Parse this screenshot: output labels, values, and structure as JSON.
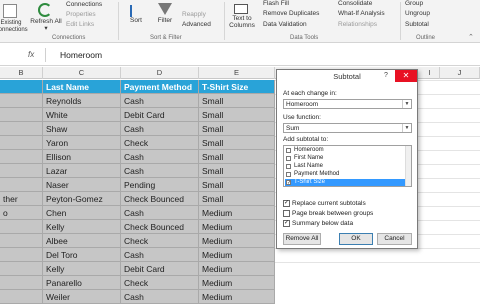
{
  "ribbon": {
    "existing_connections": "Existing Connections",
    "refresh_all": "Refresh All",
    "refresh_arrow": "▾",
    "connections": "Connections",
    "properties": "Properties",
    "edit_links": "Edit Links",
    "group_connections": "Connections",
    "sort": "Sort",
    "filter": "Filter",
    "reapply": "Reapply",
    "advanced": "Advanced",
    "group_sort_filter": "Sort & Filter",
    "text_to_columns": "Text to Columns",
    "flash_fill": "Flash Fill",
    "remove_duplicates": "Remove Duplicates",
    "data_validation": "Data Validation",
    "consolidate": "Consolidate",
    "what_if": "What-If Analysis",
    "relationships": "Relationships",
    "group_data_tools": "Data Tools",
    "group_btn": "Group",
    "ungroup": "Ungroup",
    "subtotal": "Subtotal",
    "group_outline": "Outline"
  },
  "formula_bar": {
    "fx": "fx",
    "value": "Homeroom"
  },
  "columns": [
    "B",
    "C",
    "D",
    "E",
    "I",
    "J"
  ],
  "table": {
    "headers": [
      "",
      "Last Name",
      "Payment Method",
      "T-Shirt Size"
    ],
    "rows": [
      [
        "",
        "Reynolds",
        "Cash",
        "Small"
      ],
      [
        "",
        "White",
        "Debit Card",
        "Small"
      ],
      [
        "",
        "Shaw",
        "Cash",
        "Small"
      ],
      [
        "",
        "Yaron",
        "Check",
        "Small"
      ],
      [
        "",
        "Ellison",
        "Cash",
        "Small"
      ],
      [
        "",
        "Lazar",
        "Cash",
        "Small"
      ],
      [
        "",
        "Naser",
        "Pending",
        "Small"
      ],
      [
        "ther",
        "Peyton-Gomez",
        "Check Bounced",
        "Small"
      ],
      [
        "o",
        "Chen",
        "Cash",
        "Medium"
      ],
      [
        "",
        "Kelly",
        "Check Bounced",
        "Medium"
      ],
      [
        "",
        "Albee",
        "Check",
        "Medium"
      ],
      [
        "",
        "Del Toro",
        "Cash",
        "Medium"
      ],
      [
        "",
        "Kelly",
        "Debit Card",
        "Medium"
      ],
      [
        "",
        "Panarello",
        "Check",
        "Medium"
      ],
      [
        "",
        "Weiler",
        "Cash",
        "Medium"
      ]
    ]
  },
  "dialog": {
    "title": "Subtotal",
    "help": "?",
    "close": "✕",
    "change_label": "At each change in:",
    "change_value": "Homeroom",
    "function_label": "Use function:",
    "function_value": "Sum",
    "add_label": "Add subtotal to:",
    "list": [
      "Homeroom",
      "First Name",
      "Last Name",
      "Payment Method",
      "T-Shirt Size"
    ],
    "opt_replace": "Replace current subtotals",
    "opt_pagebreak": "Page break between groups",
    "opt_summary": "Summary below data",
    "check_mark": "✓",
    "dropdown_arrow": "▼",
    "remove_all": "Remove All",
    "ok": "OK",
    "cancel": "Cancel"
  },
  "colors": {
    "header_blue": "#29a3d8",
    "selection_gray": "#c6c6c6",
    "close_red": "#e81123"
  }
}
